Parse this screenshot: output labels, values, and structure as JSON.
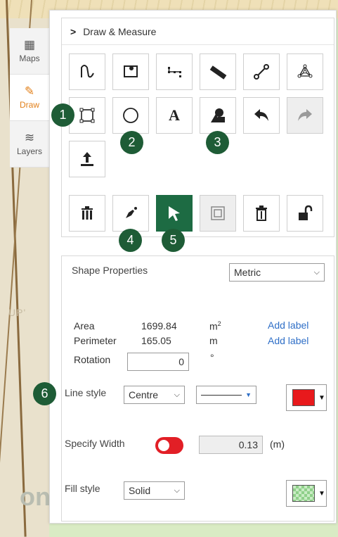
{
  "side_tabs": [
    {
      "label": "Maps",
      "icon": "grid-map-icon"
    },
    {
      "label": "Draw",
      "icon": "pencil-icon"
    },
    {
      "label": "Layers",
      "icon": "layers-icon"
    }
  ],
  "map": {
    "bg_text_1": "UP'",
    "bg_text_2": "on"
  },
  "header": {
    "title": "Draw & Measure"
  },
  "tool_rows": {
    "row1": [
      "freehand-draw-icon",
      "place-marker-icon",
      "path-nodes-icon",
      "ruler-icon",
      "line-segment-icon",
      "polygon-vertices-icon"
    ],
    "row2": [
      "rectangle-icon",
      "circle-icon",
      "text-icon",
      "shape-fill-icon",
      "undo-icon",
      "redo-icon"
    ],
    "row3": [
      "import-upload-icon"
    ],
    "row4": [
      "delete-all-icon",
      "edit-pen-icon",
      "select-pointer-icon",
      "group-select-icon",
      "delete-icon",
      "unlock-icon"
    ],
    "text_tool_glyph": "A"
  },
  "badges": [
    "1",
    "2",
    "3",
    "4",
    "5",
    "6"
  ],
  "props": {
    "title": "Shape Properties",
    "units": "Metric",
    "area_label": "Area",
    "area_value": "1699.84",
    "area_unit": "m",
    "area_unit_sup": "2",
    "perimeter_label": "Perimeter",
    "perimeter_value": "165.05",
    "perimeter_unit": "m",
    "add_label": "Add label",
    "rotation_label": "Rotation",
    "rotation_value": "0",
    "rotation_unit": "°",
    "line_style_label": "Line style",
    "line_position": "Centre",
    "specify_width_label": "Specify Width",
    "width_value": "0.13",
    "width_unit": "(m)",
    "fill_style_label": "Fill style",
    "fill_style": "Solid"
  },
  "colors": {
    "accent": "#1d6b43",
    "badge": "#1e5c36",
    "line_color": "#e8191c",
    "fill_color": "#8fd08a",
    "toggle": "#e21f26",
    "link": "#2f6fc7"
  }
}
